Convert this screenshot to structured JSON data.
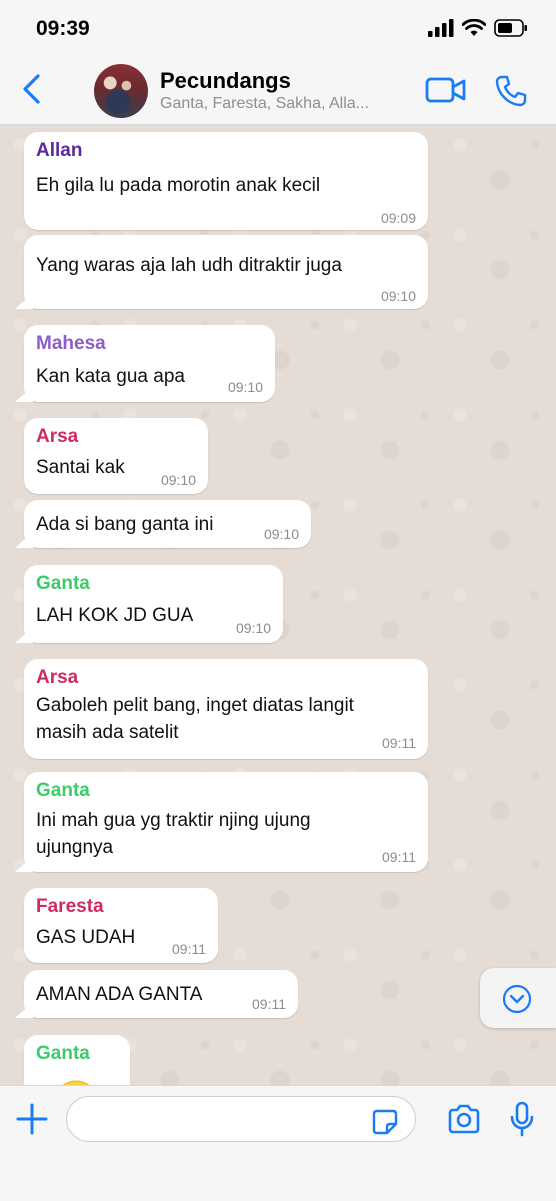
{
  "status_bar": {
    "time": "09:39"
  },
  "header": {
    "title": "Pecundangs",
    "subtitle": "Ganta, Faresta, Sakha, Alla..."
  },
  "colors": {
    "accent": "#1a7cf5",
    "Allan": "#5b2a9e",
    "Mahesa": "#8a5ec8",
    "Arsa": "#d02b5f",
    "Ganta": "#3ecc6a",
    "Faresta": "#d02b5f"
  },
  "messages": [
    {
      "sender": "Allan",
      "text": [
        "Eh gila lu pada morotin anak kecil"
      ],
      "time": "09:09"
    },
    {
      "sender": "",
      "text": [
        "Yang waras aja lah udh ditraktir juga"
      ],
      "time": "09:10"
    },
    {
      "sender": "Mahesa",
      "text": [
        "Kan kata gua apa"
      ],
      "time": "09:10"
    },
    {
      "sender": "Arsa",
      "text": [
        "Santai kak"
      ],
      "time": "09:10"
    },
    {
      "sender": "",
      "text": [
        "Ada si bang ganta ini"
      ],
      "time": "09:10"
    },
    {
      "sender": "Ganta",
      "text": [
        "LAH KOK JD GUA"
      ],
      "time": "09:10"
    },
    {
      "sender": "Arsa",
      "text": [
        "Gaboleh pelit bang, inget diatas langit",
        "masih ada satelit"
      ],
      "time": "09:11"
    },
    {
      "sender": "Ganta",
      "text": [
        "Ini mah gua yg traktir njing ujung",
        "ujungnya"
      ],
      "time": "09:11"
    },
    {
      "sender": "Faresta",
      "text": [
        "GAS UDAH"
      ],
      "time": "09:11"
    },
    {
      "sender": "",
      "text": [
        "AMAN ADA GANTA"
      ],
      "time": "09:11"
    },
    {
      "sender": "Ganta",
      "text": [],
      "time": ""
    }
  ],
  "icons": {
    "back": "chevron-left-icon",
    "video": "video-call-icon",
    "phone": "phone-icon",
    "scroll": "chevron-down-icon",
    "attach": "plus-icon",
    "sticker": "sticker-icon",
    "camera": "camera-icon",
    "mic": "microphone-icon"
  },
  "input": {
    "value": "",
    "placeholder": ""
  }
}
